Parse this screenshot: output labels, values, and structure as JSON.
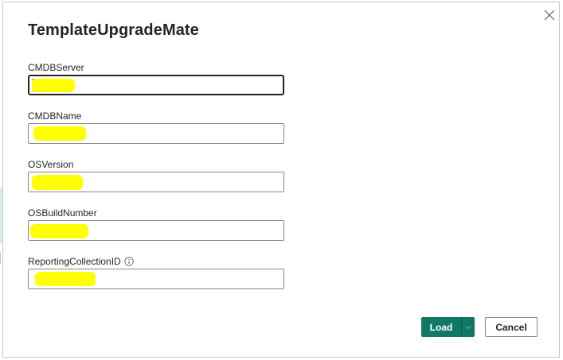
{
  "dialog": {
    "title": "TemplateUpgradeMate",
    "close_icon": "close-icon"
  },
  "fields": [
    {
      "label": "CMDBServer",
      "value": "",
      "redacted": true,
      "focused": true
    },
    {
      "label": "CMDBName",
      "value": "",
      "redacted": true,
      "focused": false
    },
    {
      "label": "OSVersion",
      "value": "",
      "redacted": true,
      "focused": false
    },
    {
      "label": "OSBuildNumber",
      "value": "",
      "redacted": true,
      "focused": false
    },
    {
      "label": "ReportingCollectionID",
      "value": "",
      "redacted": true,
      "focused": false,
      "info_icon": "info-icon"
    }
  ],
  "buttons": {
    "load_label": "Load",
    "load_split_icon": "chevron-down-icon",
    "cancel_label": "Cancel"
  },
  "colors": {
    "primary": "#117865",
    "redaction": "#ffff00",
    "text": "#252423",
    "border": "#8a8886"
  }
}
